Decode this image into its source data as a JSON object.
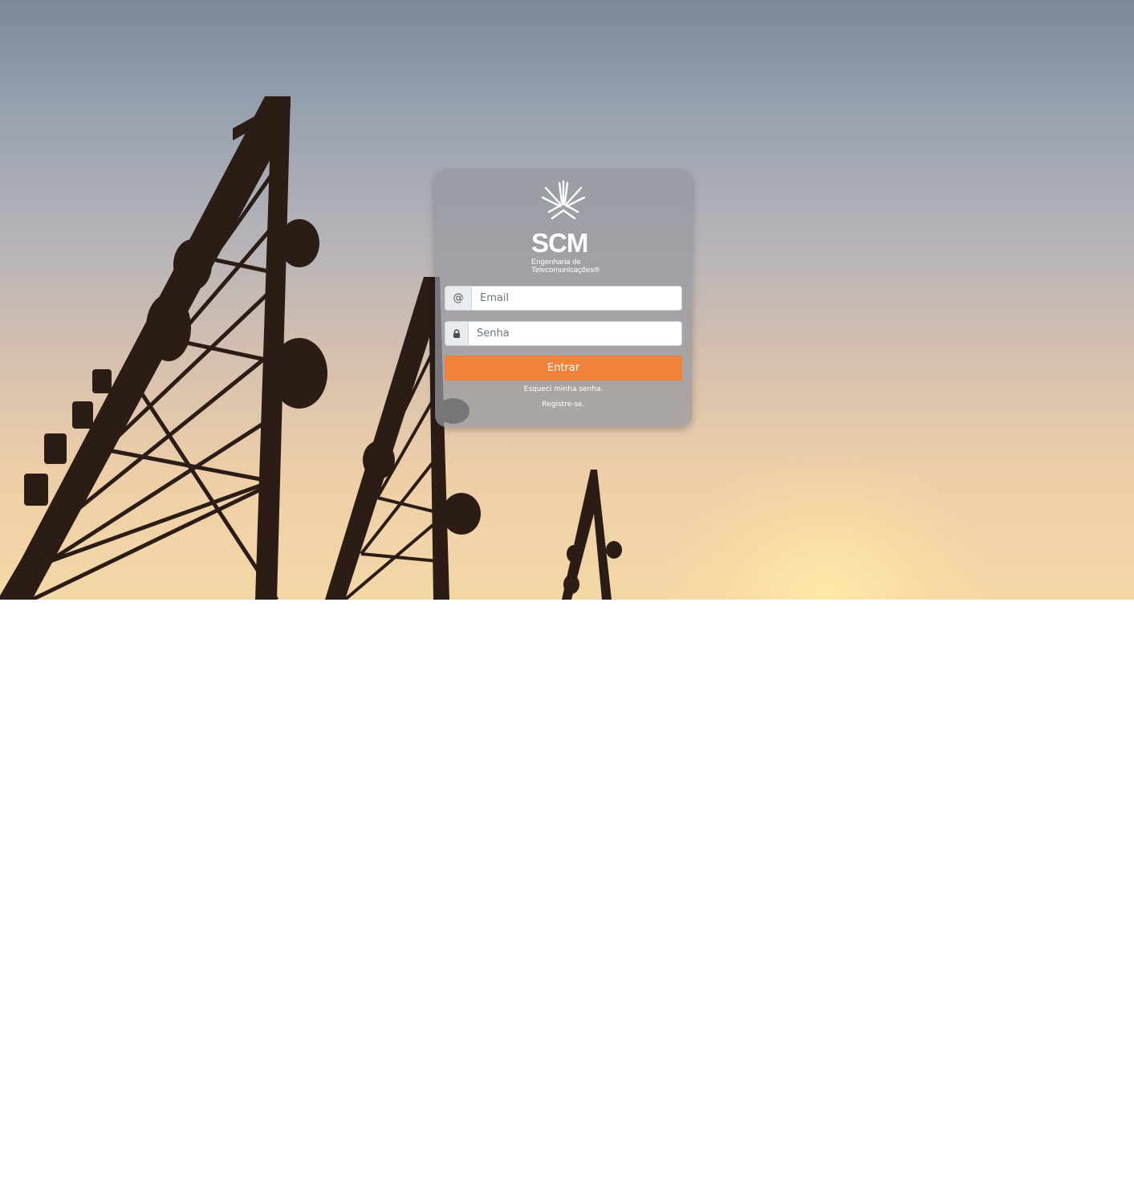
{
  "brand": {
    "name": "SCM",
    "subtitle_line1": "Engenharia de",
    "subtitle_line2": "Telecomunicações®",
    "logo_icon": "scm-fan-logo-icon"
  },
  "login": {
    "email_addon": "@",
    "email_placeholder": "Email",
    "password_icon": "lock-icon",
    "password_placeholder": "Senha",
    "submit_label": "Entrar",
    "forgot_link": "Esqueci minha senha.",
    "register_link": "Registre-se."
  },
  "colors": {
    "accent": "#f0823c",
    "card": "#96989f"
  }
}
